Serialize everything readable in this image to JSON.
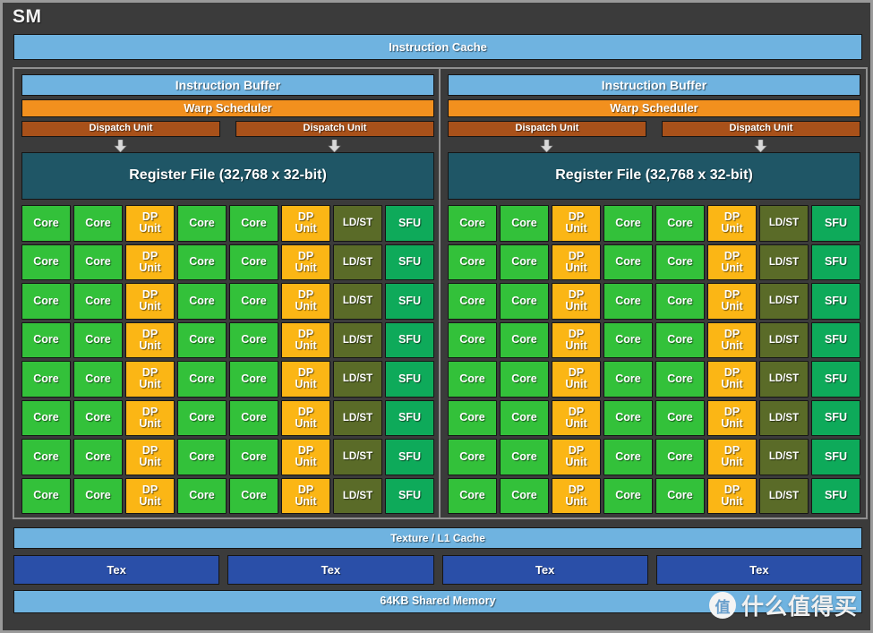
{
  "diagram": {
    "title": "SM",
    "instruction_cache": "Instruction Cache",
    "texture_l1_cache": "Texture / L1 Cache",
    "shared_memory": "64KB Shared Memory",
    "tex_blocks": [
      {
        "label": "Tex"
      },
      {
        "label": "Tex"
      },
      {
        "label": "Tex"
      },
      {
        "label": "Tex"
      }
    ],
    "processing_blocks": [
      {
        "instruction_buffer": "Instruction Buffer",
        "warp_scheduler": "Warp Scheduler",
        "dispatch_units": [
          "Dispatch Unit",
          "Dispatch Unit"
        ],
        "register_file": "Register File (32,768 x 32-bit)",
        "row_template": [
          "Core",
          "Core",
          "DP Unit",
          "Core",
          "Core",
          "DP Unit",
          "LD/ST",
          "SFU"
        ],
        "row_count": 8
      },
      {
        "instruction_buffer": "Instruction Buffer",
        "warp_scheduler": "Warp Scheduler",
        "dispatch_units": [
          "Dispatch Unit",
          "Dispatch Unit"
        ],
        "register_file": "Register File (32,768 x 32-bit)",
        "row_template": [
          "Core",
          "Core",
          "DP Unit",
          "Core",
          "Core",
          "DP Unit",
          "LD/ST",
          "SFU"
        ],
        "row_count": 8
      }
    ]
  },
  "watermark": {
    "badge_glyph": "值",
    "text": "什么值得买"
  },
  "colors": {
    "frame_bg": "#3b3b3b",
    "frame_border": "#9a9a9a",
    "cache_blue": "#6fb3e0",
    "warp_orange": "#f2901e",
    "dispatch_brown": "#a8511a",
    "register_teal": "#1f5666",
    "core_green": "#33c13a",
    "dp_yellow": "#fbb615",
    "ldst_olive": "#5a6b28",
    "sfu_green": "#0eaa5a",
    "tex_blue": "#2a4fa8"
  }
}
